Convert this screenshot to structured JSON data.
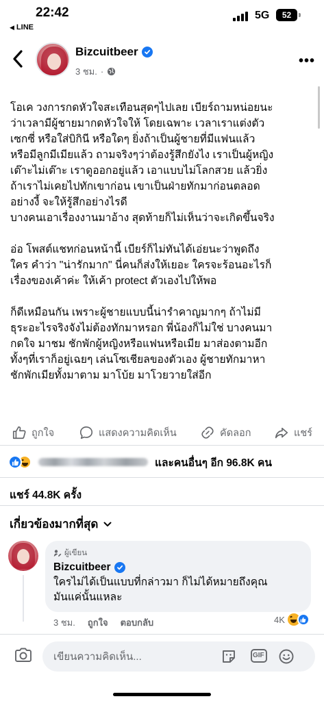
{
  "status_bar": {
    "time": "22:42",
    "back_app": "LINE",
    "network": "5G",
    "battery": "52"
  },
  "header": {
    "page_name": "Bizcuitbeer",
    "time_ago": "3 ชม.",
    "separator": "·"
  },
  "post": {
    "paragraphs": [
      "โอเค วงการกดหัวใจสะเทือนสุดๆไปเลย เบียร์ถามหน่อยนะ\nว่าเวลามีผู้ชายมากดหัวใจให้ โดยเฉพาะ เวลาเราแต่งตัว\nเซกซี่ หรือใส่บิกินี หรือใดๆ ยิ่งถ้าเป็นผู้ชายที่มีแฟนแล้ว\nหรือมีลูกมีเมียแล้ว ถามจริงๆว่าต้องรู้สึกยังไง เราเป็นผู้หญิง\nเต๊าะไม่เต๊าะ เราดูออกอยู่แล้ว เอาแบบไม่โลกสวย แล้วยิ่ง\nถ้าเราไม่เคยไปทักเขาก่อน เขาเป็นฝ่ายทักมาก่อนตลอด\nอย่างงี้ จะให้รู้สึกอย่างไรดี\nบางคนเอาเรื่องงานมาอ้าง สุดท้ายก็ไม่เห็นว่าจะเกิดขึ้นจริง",
      "อ่อ โพสต์แชทก่อนหน้านี้ เบียร์ก็ไม่ทันได้เอ่ยนะว่าพูดถึง\nใคร คำว่า \"น่ารักมาก\" นี่คนก็ส่งให้เยอะ ใครจะร้อนอะไรก็\nเรื่องของเค้าค่ะ ให้เค้า protect ตัวเองไปให้พอ",
      "ก็ดีเหมือนกัน เพราะผู้ชายแบบนี้น่ารำคาญมากๆ ถ้าไม่มี\nธุระอะไรจริงจังไม่ต้องทักมาหรอก พี่น้องก็ไม่ใช่ บางคนมา\nกดใจ มาชม ชักพักผู้หญิงหรือแฟนหรือเมีย มาส่องตามอีก\nทั้งๆที่เราก็อยู่เฉยๆ เล่นโซเชียลของตัวเอง ผู้ชายทักมาหา\nชักพักเมียทั้งมาตาม มาโบ้ย มาโวยวายใส่อีก"
    ]
  },
  "actions": {
    "like": "ถูกใจ",
    "comment": "แสดงความคิดเห็น",
    "copy": "คัดลอก",
    "share": "แชร์"
  },
  "reactions": {
    "summary": "และคนอื่นๆ อีก 96.8K คน"
  },
  "shares": "แชร์ 44.8K ครั้ง",
  "relevance_filter": "เกี่ยวข้องมากที่สุด",
  "comment": {
    "badge": "ผู้เขียน",
    "author": "Bizcuitbeer",
    "text": "ใครไม่ได้เป็นแบบที่กล่าวมา ก็ไม่ได้หมายถึงคุณ\nมันแค่นั้นแหละ",
    "time_ago": "3 ชม.",
    "like": "ถูกใจ",
    "reply": "ตอบกลับ",
    "reaction_count": "4K"
  },
  "composer": {
    "placeholder": "เขียนความคิดเห็น...",
    "gif_label": "GIF"
  },
  "colors": {
    "brand_blue": "#1877f2",
    "secondary_text": "#65676b",
    "bubble_bg": "#f0f2f5"
  }
}
